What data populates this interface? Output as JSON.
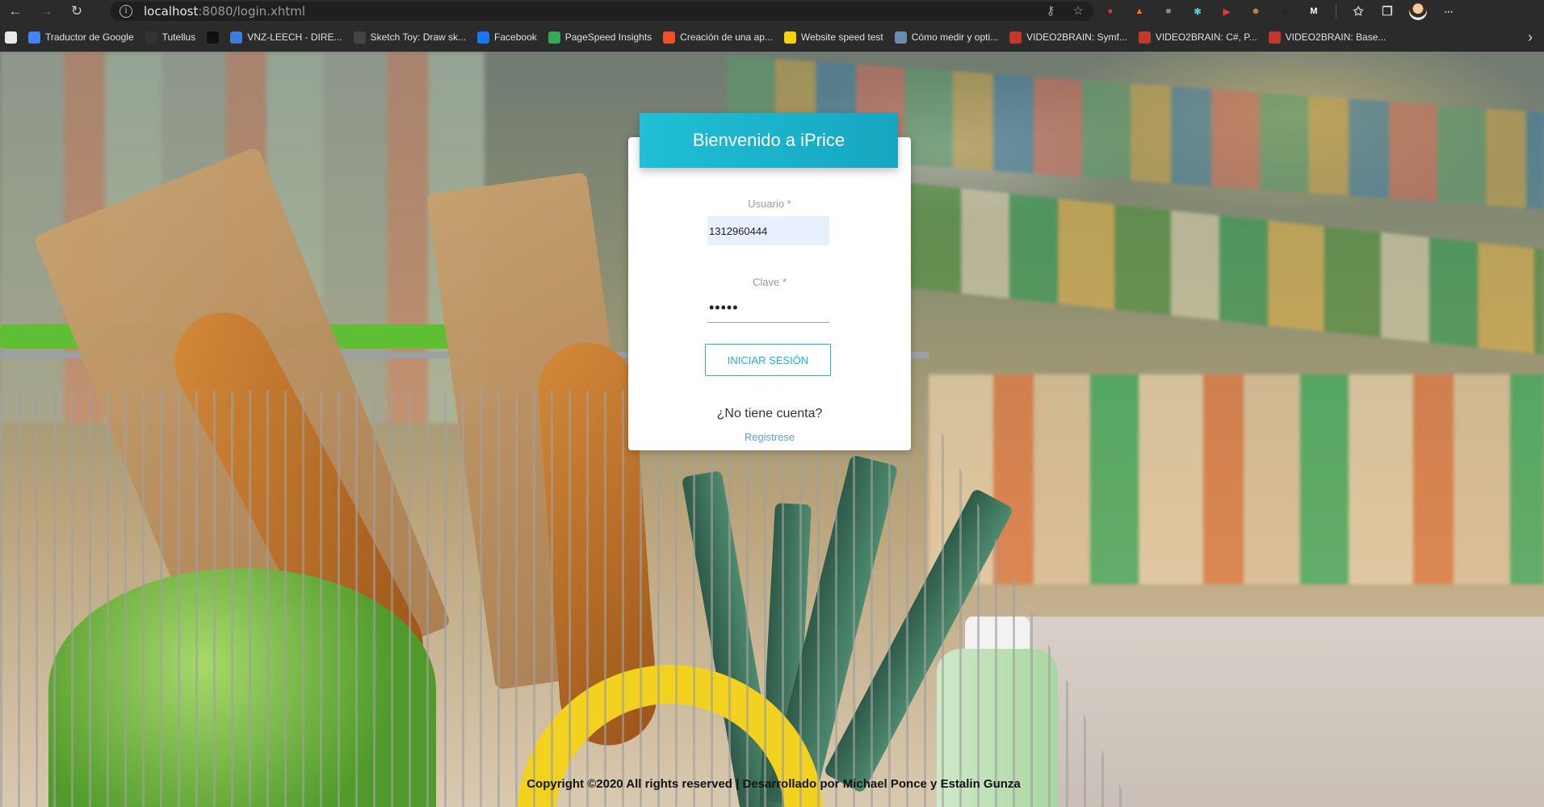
{
  "browser": {
    "url_host": "localhost",
    "url_port": ":8080",
    "url_path": "/login.xhtml",
    "bookmarks": [
      {
        "label": "",
        "icon": "github-icon",
        "color": "#e8e8e8"
      },
      {
        "label": "Traductor de Google",
        "icon": "google-translate-icon",
        "color": "#4285f4"
      },
      {
        "label": "Tutellus",
        "icon": "tutellus-icon",
        "color": "#333333"
      },
      {
        "label": "",
        "icon": "p-icon",
        "color": "#111111"
      },
      {
        "label": "VNZ-LEECH - DIRE...",
        "icon": "star-icon",
        "color": "#3b7dd8"
      },
      {
        "label": "Sketch Toy: Draw sk...",
        "icon": "sketch-icon",
        "color": "#444444"
      },
      {
        "label": "Facebook",
        "icon": "facebook-icon",
        "color": "#1877f2"
      },
      {
        "label": "PageSpeed Insights",
        "icon": "pagespeed-icon",
        "color": "#34a853"
      },
      {
        "label": "Creación de una ap...",
        "icon": "windows-icon",
        "color": "#f25022"
      },
      {
        "label": "Website speed test",
        "icon": "p-icon",
        "color": "#f5d300"
      },
      {
        "label": "Cómo medir y opti...",
        "icon": "person-icon",
        "color": "#6a8caf"
      },
      {
        "label": "VIDEO2BRAIN: Symf...",
        "icon": "video2brain-icon",
        "color": "#c0392b"
      },
      {
        "label": "VIDEO2BRAIN: C#, P...",
        "icon": "video2brain-icon",
        "color": "#c0392b"
      },
      {
        "label": "VIDEO2BRAIN: Base...",
        "icon": "video2brain-icon",
        "color": "#c0392b"
      }
    ],
    "extensions": [
      {
        "icon": "extension-red-icon",
        "color": "#e53935",
        "glyph": "●"
      },
      {
        "icon": "extension-fire-icon",
        "color": "#f57c00",
        "glyph": "▲"
      },
      {
        "icon": "extension-gray-icon",
        "color": "#8a8a8a",
        "glyph": "■"
      },
      {
        "icon": "extension-react-icon",
        "color": "#61dafb",
        "glyph": "✻"
      },
      {
        "icon": "extension-play-icon",
        "color": "#e53935",
        "glyph": "▶"
      },
      {
        "icon": "extension-face-icon",
        "color": "#c98a4a",
        "glyph": "☻"
      },
      {
        "icon": "extension-tree-icon",
        "color": "#222222",
        "glyph": "♣"
      },
      {
        "icon": "extension-m-icon",
        "color": "#ffffff",
        "glyph": "M"
      }
    ]
  },
  "login": {
    "title": "Bienvenido a iPrice",
    "username_label": "Usuario *",
    "username_value": "1312960444",
    "password_label": "Clave *",
    "password_value": "•••••",
    "submit_label": "INICIAR SESIÓN",
    "no_account_text": "¿No tiene cuenta?",
    "register_label": "Registrese"
  },
  "footer": {
    "text": "Copyright ©2020 All rights reserved | Desarrollado por Michael Ponce y Estalin Gunza"
  },
  "colors": {
    "accent": "#1fbfd6",
    "link": "#5b9fd8",
    "autofill_bg": "#e8f0fe"
  }
}
